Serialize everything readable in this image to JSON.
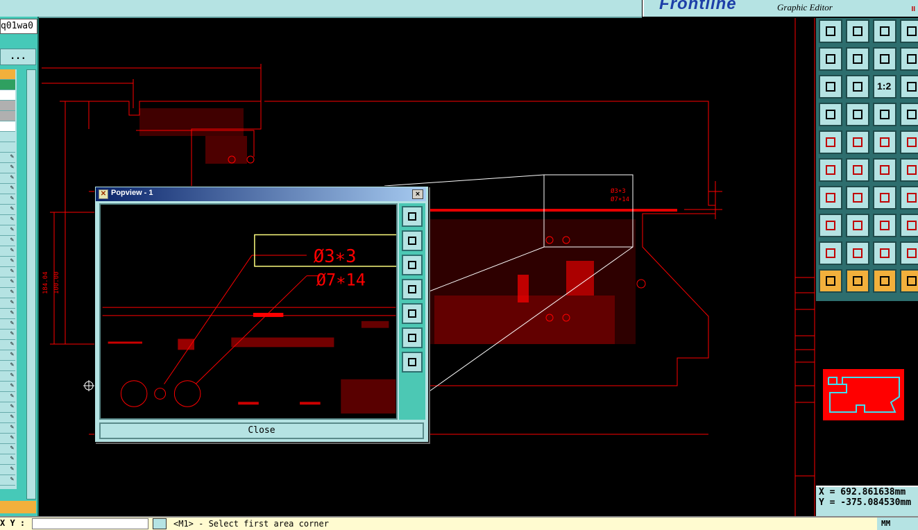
{
  "header": {
    "brand_logo": "Frontline",
    "brand_subtitle": "Graphic Editor",
    "pause_glyph": "II"
  },
  "left_panel": {
    "job_name": "q01wa0",
    "more_button": "...",
    "layer_colors": [
      "#f2b03c",
      "#2fa060",
      "#ffffff",
      "#b0b0b0",
      "#b0b0b0",
      "#ffffff"
    ]
  },
  "popview": {
    "title": "Popview - 1",
    "close_x": "×",
    "close_button": "Close",
    "annotations": {
      "hole_a": "Ø3∗3",
      "hole_b": "Ø7∗14"
    }
  },
  "canvas": {
    "dims": {
      "d1": "184.04",
      "d2": "100.00"
    },
    "annotations": {
      "hole_a": "Ø3∗3",
      "hole_b": "Ø7∗14"
    }
  },
  "toolbar": {
    "icons": [
      "layer-up-icon",
      "layer-down-icon",
      "home-icon",
      "window-icon",
      "import-left-icon",
      "export-right-icon",
      "undo-icon",
      "window2-icon",
      "fit-icon",
      "center-icon",
      "ratio-1-2-icon",
      "help-icon",
      "palette-icon",
      "probe-icon",
      "traffic-icon",
      "traffic2-icon",
      "pad-point-icon",
      "diagonal-icon",
      "ruler-icon",
      "dot-icon",
      "net-nodes-icon",
      "cross-icon",
      "pin-icon",
      "pin2-icon",
      "angle-icon",
      "arrow-icon",
      "arc-icon",
      "split-icon",
      "pad-icon",
      "line-icon",
      "measure-icon",
      "sym-icon",
      "triangle-icon",
      "triangle-up-icon",
      "trapezoid-icon",
      "slope-icon",
      "cursor-icon",
      "cursor2-icon",
      "cursor3-icon",
      "cursor4-icon"
    ],
    "ratio_label": "1:2"
  },
  "coords": {
    "x": "X =  692.861638mm",
    "y": "Y = -375.084530mm"
  },
  "status": {
    "label": "X Y :",
    "message": "<M1> - Select first area corner",
    "unit": "MM"
  },
  "colors": {
    "trace": "#ff0000",
    "panel": "#b5e3e3",
    "teal": "#46c9b8",
    "highlight": "#ffff80"
  }
}
